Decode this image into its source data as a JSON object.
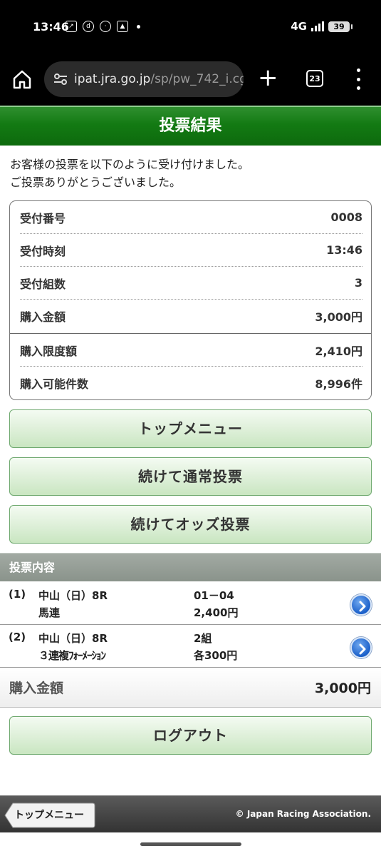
{
  "status_bar": {
    "time": "13:46",
    "network": "4G",
    "battery": "39"
  },
  "browser": {
    "url_host": "ipat.jra.go.jp",
    "url_path": "/sp/pw_742_i.cg",
    "tab_count": "23"
  },
  "page": {
    "title": "投票結果",
    "intro_line1": "お客様の投票を以下のように受け付けました。",
    "intro_line2": "ご投票ありがとうございました。"
  },
  "receipt": {
    "rows": [
      {
        "label": "受付番号",
        "value": "0008"
      },
      {
        "label": "受付時刻",
        "value": "13:46"
      },
      {
        "label": "受付組数",
        "value": "3"
      },
      {
        "label": "購入金額",
        "value": "3,000円"
      },
      {
        "label": "購入限度額",
        "value": "2,410円"
      },
      {
        "label": "購入可能件数",
        "value": "8,996件"
      }
    ]
  },
  "buttons": {
    "top_menu": "トップメニュー",
    "continue_normal": "続けて通常投票",
    "continue_odds": "続けてオッズ投票",
    "logout": "ログアウト"
  },
  "votes": {
    "heading": "投票内容",
    "items": [
      {
        "num": "(1)",
        "race": "中山（日）8R",
        "type": "馬連",
        "combo": "01－04",
        "amount": "2,400円"
      },
      {
        "num": "(2)",
        "race": "中山（日）8R",
        "type": "３連複ﾌｫｰﾒｰｼｮﾝ",
        "combo": "2組",
        "amount": "各300円"
      }
    ],
    "total_label": "購入金額",
    "total_value": "3,000円"
  },
  "footer": {
    "back_label": "トップメニュー",
    "copyright": "© Japan Racing Association."
  }
}
